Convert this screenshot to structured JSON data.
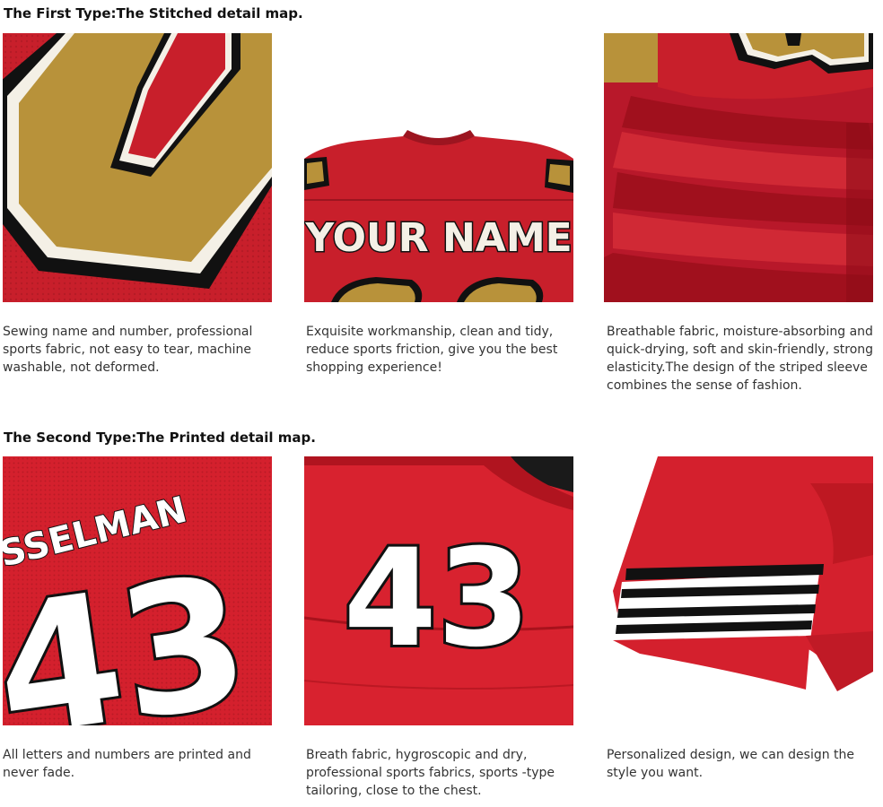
{
  "sections": [
    {
      "heading": "The First Type:The Stitched detail map.",
      "items": [
        {
          "image": "stitched-number-closeup",
          "caption": "Sewing name and number, professional sports fabric, not easy to tear, machine washable, not deformed."
        },
        {
          "image": "stitched-name-back",
          "overlay_text": "YOUR NAME",
          "caption": "Exquisite workmanship, clean and tidy, reduce sports friction, give you the best shopping experience!"
        },
        {
          "image": "stitched-sleeve-fabric",
          "caption": "Breathable fabric, moisture-absorbing and quick-drying, soft and skin-friendly, strong elasticity.The design of the striped sleeve combines the sense of fashion."
        }
      ]
    },
    {
      "heading": "The Second Type:The Printed detail map.",
      "items": [
        {
          "image": "printed-name-number-closeup",
          "overlay_text": "SSELMAN",
          "overlay_number": "43",
          "caption": "All letters and numbers are printed and never fade."
        },
        {
          "image": "printed-number-back",
          "overlay_number": "43",
          "caption": "Breath fabric, hygroscopic and dry, professional sports fabrics, sports -type tailoring, close to the chest."
        },
        {
          "image": "printed-striped-sleeve",
          "caption": "Personalized design, we can design the style you want."
        }
      ]
    }
  ],
  "colors": {
    "jersey_red": "#c81f2b",
    "gold": "#b8923a",
    "black": "#111111",
    "white": "#ffffff"
  }
}
